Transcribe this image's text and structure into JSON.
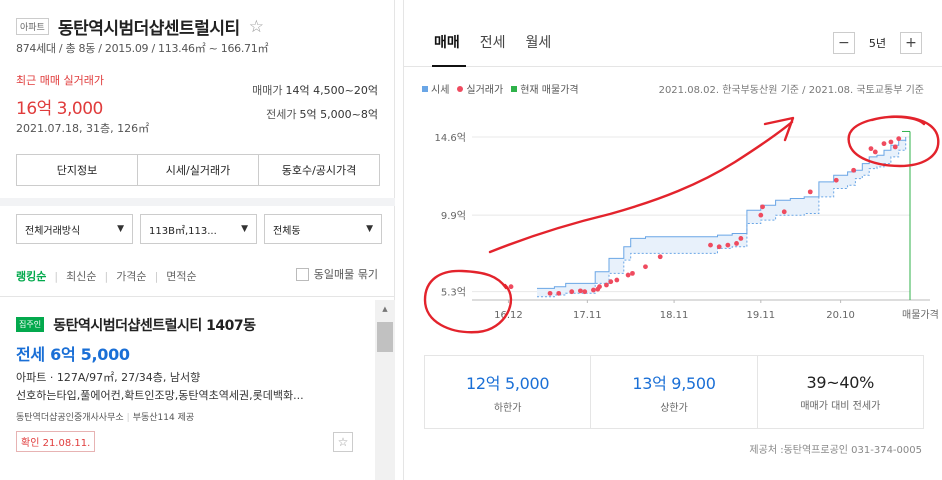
{
  "complex": {
    "type_badge": "아파트",
    "name": "동탄역시범더샵센트럴시티",
    "star": "☆",
    "info": "874세대 / 총 8동 / 2015.09 / 113.46㎡ ~ 166.71㎡"
  },
  "recent": {
    "label": "최근 매매 실거래가",
    "price": "16억 3,000",
    "date": "2021.07.18, 31층, 126㎡",
    "sale_label": "매매가",
    "sale_range": "14억 4,500~20억",
    "lease_label": "전세가",
    "lease_range": "5억 5,000~8억"
  },
  "buttons": [
    "단지정보",
    "시세/실거래가",
    "동호수/공시가격"
  ],
  "filters": {
    "deal": "전체거래방식",
    "area": "113B㎡,113...",
    "dong": "전체동"
  },
  "sort": {
    "items": [
      "랭킹순",
      "최신순",
      "가격순",
      "면적순"
    ],
    "bundle_label": "동일매물 묶기"
  },
  "listing": {
    "badge": "집주인",
    "title": "동탄역시범더샵센트럴시티 1407동",
    "price": "전세 6억 5,000",
    "spec": "아파트 · 127A/97㎡, 27/34층, 남서향",
    "desc": "선호하는타입,풀에어컨,확트인조망,동탄역초역세권,롯데백화...",
    "agent": "동탄역더샵공인중개사사무소",
    "agent_source": "부동산114 제공",
    "confirm": "확인 21.08.11."
  },
  "tabs": [
    "매매",
    "전세",
    "월세"
  ],
  "period": {
    "value": "5년",
    "minus": "−",
    "plus": "+"
  },
  "legend": {
    "items": [
      {
        "label": "시세",
        "color": "#6aa6e6",
        "shape": "square"
      },
      {
        "label": "실거래가",
        "color": "#ef4b5f",
        "shape": "dot"
      },
      {
        "label": "현재 매물가격",
        "color": "#2fb24a",
        "shape": "square"
      }
    ],
    "source": "2021.08.02. 한국부동산원 기준 / 2021.08. 국토교통부 기준"
  },
  "chart_data": {
    "type": "scatter",
    "title": "",
    "y_tick_labels": [
      "14.6억",
      "9.9억",
      "5.3억"
    ],
    "y_ticks": [
      14.6,
      9.9,
      5.3
    ],
    "x_tick_labels": [
      "16.12",
      "17.11",
      "18.11",
      "19.11",
      "20.10",
      "매물가격"
    ],
    "x_ticks": [
      2016.92,
      2017.83,
      2018.83,
      2019.83,
      2020.75
    ],
    "xlim": [
      2016.5,
      2021.55
    ],
    "ylim": [
      4.8,
      15.5
    ],
    "current_listing_x": 2021.55,
    "current_listing_range": [
      14.45,
      20.0
    ],
    "series": [
      {
        "name": "시세",
        "band": {
          "x": [
            2017.25,
            2017.45,
            2017.58,
            2017.92,
            2018.08,
            2018.25,
            2018.33,
            2018.5,
            2018.67,
            2019.0,
            2019.33,
            2019.5,
            2019.67,
            2019.83,
            2020.0,
            2020.17,
            2020.33,
            2020.5,
            2020.67,
            2020.83,
            2020.92,
            2021.0,
            2021.08,
            2021.17,
            2021.25,
            2021.33,
            2021.42,
            2021.5
          ],
          "lower": [
            5.0,
            5.1,
            5.2,
            5.8,
            6.4,
            7.2,
            7.6,
            7.6,
            7.6,
            7.6,
            7.9,
            8.0,
            9.4,
            9.6,
            9.9,
            9.9,
            10.0,
            11.0,
            11.5,
            11.7,
            12.1,
            12.3,
            12.7,
            12.8,
            13.0,
            13.4,
            13.8,
            14.4
          ],
          "upper": [
            5.5,
            5.6,
            5.8,
            6.5,
            7.3,
            8.0,
            8.5,
            8.6,
            8.6,
            8.6,
            8.7,
            8.8,
            10.2,
            10.5,
            10.8,
            10.9,
            11.0,
            11.9,
            12.3,
            12.5,
            12.6,
            13.0,
            13.4,
            13.5,
            13.8,
            14.1,
            14.4,
            14.6
          ]
        }
      },
      {
        "name": "실거래가",
        "points": [
          [
            2016.95,
            5.6
          ],
          [
            2017.4,
            5.2
          ],
          [
            2017.5,
            5.2
          ],
          [
            2017.65,
            5.3
          ],
          [
            2017.75,
            5.35
          ],
          [
            2017.8,
            5.3
          ],
          [
            2017.9,
            5.4
          ],
          [
            2017.95,
            5.45
          ],
          [
            2017.97,
            5.6
          ],
          [
            2018.05,
            5.7
          ],
          [
            2018.1,
            5.9
          ],
          [
            2018.17,
            6.0
          ],
          [
            2018.3,
            6.3
          ],
          [
            2018.35,
            6.4
          ],
          [
            2018.5,
            6.8
          ],
          [
            2018.67,
            7.4
          ],
          [
            2019.25,
            8.1
          ],
          [
            2019.35,
            8.0
          ],
          [
            2019.45,
            8.1
          ],
          [
            2019.55,
            8.2
          ],
          [
            2019.6,
            8.5
          ],
          [
            2019.83,
            9.9
          ],
          [
            2019.85,
            10.4
          ],
          [
            2020.1,
            10.1
          ],
          [
            2020.4,
            11.3
          ],
          [
            2020.7,
            12.0
          ],
          [
            2020.9,
            12.6
          ],
          [
            2021.1,
            13.9
          ],
          [
            2021.15,
            13.7
          ],
          [
            2021.25,
            14.2
          ],
          [
            2021.42,
            14.5
          ],
          [
            2021.33,
            14.3
          ],
          [
            2021.38,
            14.0
          ]
        ]
      }
    ]
  },
  "summary": [
    {
      "value": "12억 5,000",
      "label": "하한가"
    },
    {
      "value": "13억 9,500",
      "label": "상한가"
    },
    {
      "value": "39~40%",
      "label": "매매가 대비 전세가"
    }
  ],
  "provider": "제공처 :동탄역프로공인 031-374-0005"
}
